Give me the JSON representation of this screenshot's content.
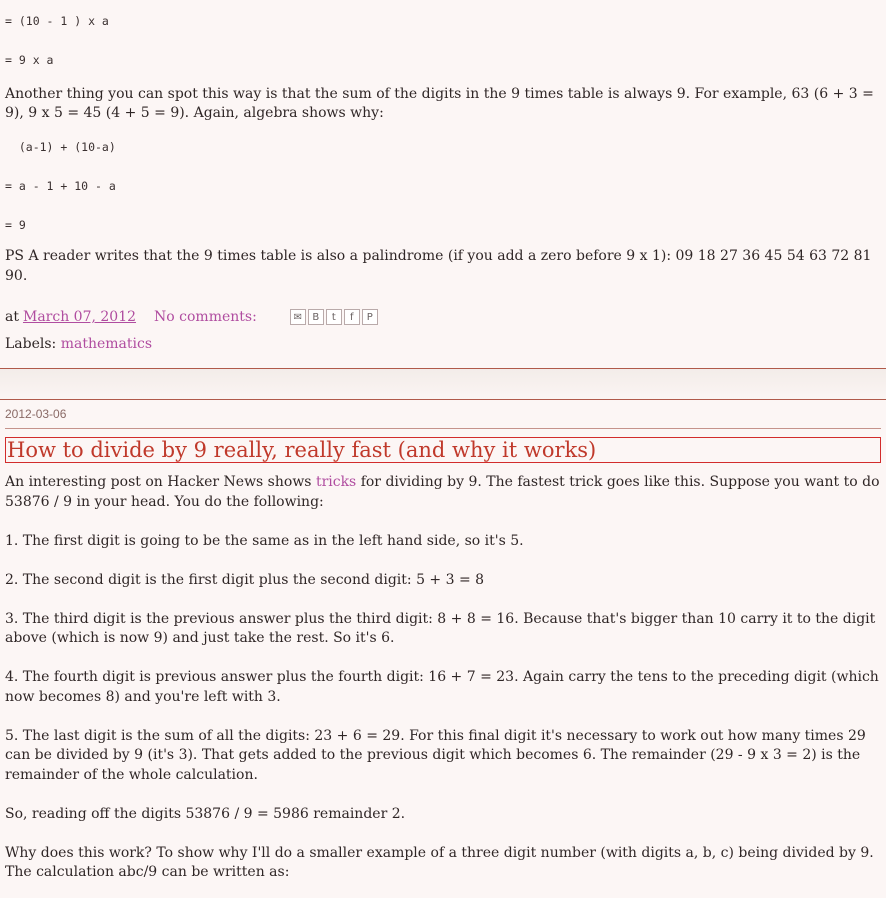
{
  "prev_post": {
    "code1": "= (10 - 1 ) x a",
    "code2": "= 9 x a",
    "para1": "Another thing you can spot this way is that the sum of the digits in the 9 times table is always 9. For example, 63 (6 + 3 = 9), 9 x 5 = 45 (4 + 5 = 9). Again, algebra shows why:",
    "code3": "  (a-1) + (10-a)",
    "code4": "= a - 1 + 10 - a",
    "code5": "= 9",
    "ps": "PS A reader writes that the 9 times table is also a palindrome (if you add a zero before 9 x 1): 09 18 27 36 45 54 63 72 81 90.",
    "footer": {
      "at": "at",
      "date_link": "March 07, 2012",
      "comments": "No comments:",
      "share_icons": [
        "email-icon",
        "blogthis-icon",
        "twitter-icon",
        "facebook-icon",
        "pinterest-icon"
      ],
      "labels_prefix": "Labels:",
      "label": "mathematics"
    }
  },
  "post": {
    "date": "2012-03-06",
    "title": "How to divide by 9 really, really fast (and why it works)",
    "intro_before": "An interesting post on Hacker News shows ",
    "intro_link": "tricks",
    "intro_after": " for dividing by 9. The fastest trick goes like this. Suppose you want to do 53876 / 9 in your head. You do the following:",
    "step1": "1. The first digit is going to be the same as in the left hand side, so it's 5.",
    "step2": "2. The second digit is the first digit plus the second digit: 5 + 3 = 8",
    "step3": "3. The third digit is the previous answer plus the third digit: 8 + 8 = 16. Because that's bigger than 10 carry it to the digit above (which is now 9) and just take the rest. So it's 6.",
    "step4": "4. The fourth digit is previous answer plus the fourth digit: 16 + 7 = 23. Again carry the tens to the preceding digit (which now becomes 8) and you're left with 3.",
    "step5": "5. The last digit is the sum of all the digits: 23 + 6 = 29. For this final digit it's necessary to work out how many times 29 can be divided by 9 (it's 3). That gets added to the previous digit which becomes 6. The remainder (29 - 9 x 3 = 2) is the remainder of the whole calculation.",
    "result": "So, reading off the digits 53876 / 9 = 5986 remainder 2.",
    "why": "Why does this work? To show why I'll do a smaller example of a three digit number (with digits a, b, c) being divided by 9. The calculation abc/9 can be written as:"
  }
}
